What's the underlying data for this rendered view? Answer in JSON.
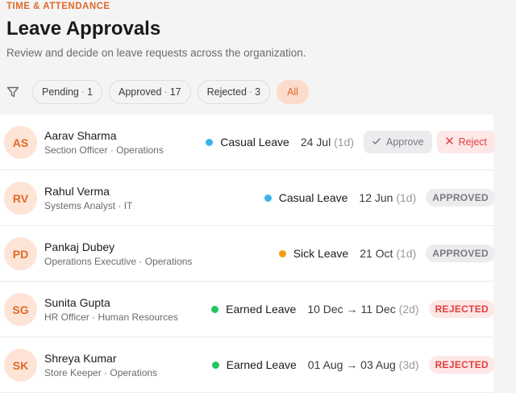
{
  "header": {
    "eyebrow": "TIME & ATTENDANCE",
    "title": "Leave Approvals",
    "subtitle": "Review and decide on leave requests across the organization."
  },
  "filters": [
    {
      "label": "Pending",
      "count": "1"
    },
    {
      "label": "Approved",
      "count": "17"
    },
    {
      "label": "Rejected",
      "count": "3"
    }
  ],
  "filter_all": "All",
  "actions": {
    "approve": "Approve",
    "reject": "Reject"
  },
  "requests": [
    {
      "initials": "AS",
      "name": "Aarav Sharma",
      "meta": "Section Officer · Operations",
      "leave_type": "Casual Leave",
      "color": "#3bb3ea",
      "date": "24 Jul",
      "duration": "(1d)",
      "status": ""
    },
    {
      "initials": "RV",
      "name": "Rahul Verma",
      "meta": "Systems Analyst · IT",
      "leave_type": "Casual Leave",
      "color": "#3bb3ea",
      "date": "12 Jun",
      "duration": "(1d)",
      "status": "APPROVED"
    },
    {
      "initials": "PD",
      "name": "Pankaj Dubey",
      "meta": "Operations Executive · Operations",
      "leave_type": "Sick Leave",
      "color": "#f29d12",
      "date": "21 Oct",
      "duration": "(1d)",
      "status": "APPROVED"
    },
    {
      "initials": "SG",
      "name": "Sunita Gupta",
      "meta": "HR Officer · Human Resources",
      "leave_type": "Earned Leave",
      "color": "#22c55e",
      "date": "10 Dec → 11 Dec",
      "duration": "(2d)",
      "status": "REJECTED"
    },
    {
      "initials": "SK",
      "name": "Shreya Kumar",
      "meta": "Store Keeper · Operations",
      "leave_type": "Earned Leave",
      "color": "#22c55e",
      "date": "01 Aug → 03 Aug",
      "duration": "(3d)",
      "status": "REJECTED"
    }
  ]
}
